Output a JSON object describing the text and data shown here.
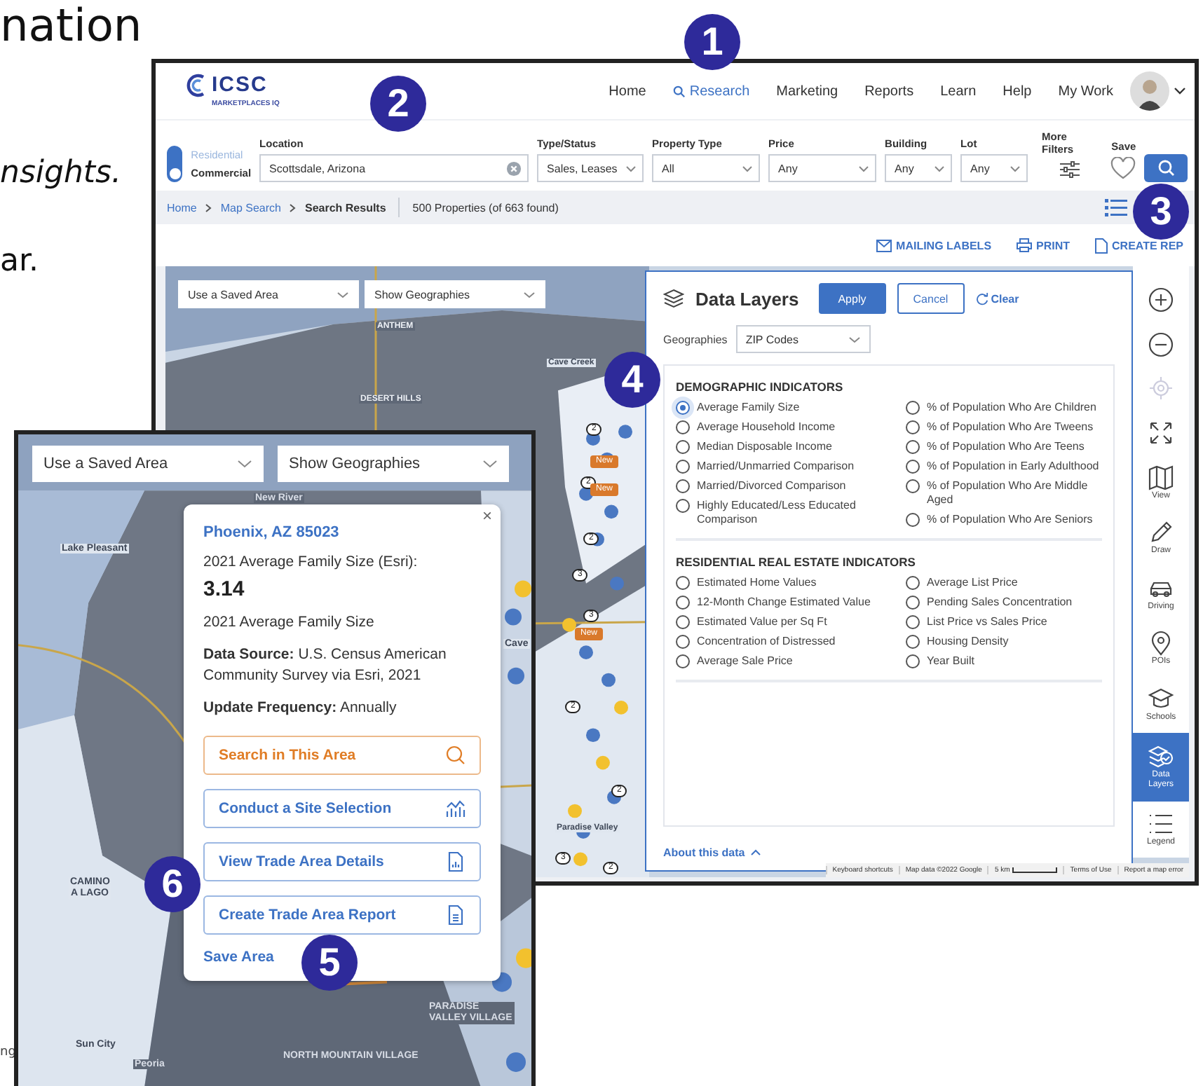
{
  "doc_text": [
    {
      "text": "nation",
      "kind": "heading"
    },
    {
      "text": "nsights.",
      "kind": "italic"
    },
    {
      "text": "ar.",
      "kind": "body"
    },
    {
      "text": "ng",
      "kind": "small"
    }
  ],
  "main_window": {
    "logo": {
      "name": "ICSC",
      "tagline": "MARKETPLACES IQ"
    },
    "nav": [
      {
        "label": "Home",
        "kind": "plain",
        "selected": false
      },
      {
        "label": "Research",
        "kind": "search",
        "selected": true
      },
      {
        "label": "Marketing",
        "kind": "plain",
        "selected": false
      },
      {
        "label": "Reports",
        "kind": "plain",
        "selected": false
      },
      {
        "label": "Learn",
        "kind": "plain",
        "selected": false
      },
      {
        "label": "Help",
        "kind": "plain",
        "selected": false
      },
      {
        "label": "My Work",
        "kind": "plain",
        "selected": false
      }
    ],
    "mode": [
      {
        "label": "Residential",
        "selected": false
      },
      {
        "label": "Commercial",
        "selected": true
      }
    ],
    "filters": [
      {
        "label": "Location",
        "value": "Scottsdale, Arizona",
        "kind": "search"
      },
      {
        "label": "Type/Status",
        "value": "Sales, Leases",
        "kind": "select"
      },
      {
        "label": "Property Type",
        "value": "All",
        "kind": "select"
      },
      {
        "label": "Price",
        "value": "Any",
        "kind": "select"
      },
      {
        "label": "Building",
        "value": "Any",
        "kind": "select"
      },
      {
        "label": "Lot",
        "value": "Any",
        "kind": "select"
      }
    ],
    "more_filters": "More Filters",
    "save": "Save",
    "breadcrumb": [
      {
        "label": "Home",
        "kind": "link"
      },
      {
        "label": "Map Search",
        "kind": "link"
      },
      {
        "label": "Search Results",
        "kind": "current"
      }
    ],
    "result_count": "500 Properties (of 663 found)",
    "actions": [
      {
        "label": "MAILING LABELS",
        "kind": "mail"
      },
      {
        "label": "PRINT",
        "kind": "print"
      },
      {
        "label": "CREATE REP",
        "kind": "report"
      }
    ],
    "map": {
      "dropdowns": [
        "Use a Saved Area",
        "Show Geographies"
      ],
      "place_labels": [
        "ANTHEM",
        "DESERT HILLS",
        "Cave Creek",
        "Paradise Valley"
      ],
      "markers": [
        "2",
        "2",
        "3",
        "3",
        "2",
        "2",
        "2",
        "3",
        "2",
        "New",
        "New",
        "New"
      ],
      "attribution": [
        "Keyboard shortcuts",
        "Map data ©2022 Google",
        "5 km",
        "Terms of Use",
        "Report a map error"
      ]
    },
    "data_layers": {
      "title": "Data Layers",
      "apply": "Apply",
      "cancel": "Cancel",
      "clear": "Clear",
      "geographies_label": "Geographies",
      "geographies_value": "ZIP Codes",
      "sections": [
        {
          "title": "DEMOGRAPHIC INDICATORS",
          "columns": [
            [
              {
                "label": "Average Family Size",
                "selected": true
              },
              {
                "label": "Average Household Income",
                "selected": false
              },
              {
                "label": "Median Disposable Income",
                "selected": false
              },
              {
                "label": "Married/Unmarried Comparison",
                "selected": false
              },
              {
                "label": "Married/Divorced Comparison",
                "selected": false
              },
              {
                "label": "Highly Educated/Less Educated Comparison",
                "selected": false
              }
            ],
            [
              {
                "label": "% of Population Who Are Children",
                "selected": false
              },
              {
                "label": "% of Population Who Are Tweens",
                "selected": false
              },
              {
                "label": "% of Population Who Are Teens",
                "selected": false
              },
              {
                "label": "% of Population in Early Adulthood",
                "selected": false
              },
              {
                "label": "% of Population Who Are Middle Aged",
                "selected": false
              },
              {
                "label": "% of Population Who Are Seniors",
                "selected": false
              }
            ]
          ]
        },
        {
          "title": "RESIDENTIAL REAL ESTATE INDICATORS",
          "columns": [
            [
              {
                "label": "Estimated Home Values",
                "selected": false
              },
              {
                "label": "12-Month Change Estimated Value",
                "selected": false
              },
              {
                "label": "Estimated Value per Sq Ft",
                "selected": false
              },
              {
                "label": "Concentration of Distressed",
                "selected": false
              },
              {
                "label": "Average Sale Price",
                "selected": false
              }
            ],
            [
              {
                "label": "Average List Price",
                "selected": false
              },
              {
                "label": "Pending Sales Concentration",
                "selected": false
              },
              {
                "label": "List Price vs Sales Price",
                "selected": false
              },
              {
                "label": "Housing Density",
                "selected": false
              },
              {
                "label": "Year Built",
                "selected": false
              }
            ]
          ]
        }
      ],
      "about": "About this data"
    },
    "tools": [
      {
        "kind": "zoom_in",
        "selected": false,
        "disabled": false
      },
      {
        "kind": "zoom_out",
        "selected": false,
        "disabled": false
      },
      {
        "kind": "locate",
        "selected": false,
        "disabled": true
      },
      {
        "kind": "expand",
        "selected": false,
        "disabled": false
      },
      {
        "kind": "view",
        "label": "View",
        "selected": false,
        "disabled": false
      },
      {
        "kind": "draw",
        "label": "Draw",
        "selected": false,
        "disabled": false
      },
      {
        "kind": "driving",
        "label": "Driving",
        "selected": false,
        "disabled": false
      },
      {
        "kind": "pois",
        "label": "POIs",
        "selected": false,
        "disabled": false
      },
      {
        "kind": "schools",
        "label": "Schools",
        "selected": false,
        "disabled": false
      },
      {
        "kind": "layers",
        "label": "Data Layers",
        "selected": true,
        "disabled": false
      },
      {
        "kind": "legend",
        "label": "Legend",
        "selected": false,
        "disabled": false
      }
    ]
  },
  "inset_window": {
    "dropdowns": [
      "Use a Saved Area",
      "Show Geographies"
    ],
    "place_labels": [
      "New River",
      "Lake Pleasant",
      "CAMINO A LAGO",
      "Sun City",
      "Peoria",
      "NORTH MOUNTAIN VILLAGE",
      "PARADISE VALLEY VILLAGE",
      "Cave"
    ],
    "popup": {
      "close": "×",
      "title": "Phoenix, AZ 85023",
      "metric_label": "2021 Average Family Size (Esri):",
      "metric_value": "3.14",
      "subtitle": "2021 Average Family Size",
      "source": "**Data Source:** U.S. Census American Community Survey via Esri, 2021",
      "frequency": "**Update Frequency:** Annually",
      "buttons": [
        {
          "label": "Search in This Area",
          "kind": "search"
        },
        {
          "label": "Conduct a Site Selection",
          "kind": "chart"
        },
        {
          "label": "View Trade Area Details",
          "kind": "details"
        },
        {
          "label": "Create Trade Area Report",
          "kind": "report"
        }
      ],
      "save": "Save Area"
    }
  },
  "callouts": [
    "1",
    "2",
    "3",
    "4",
    "5",
    "6"
  ]
}
